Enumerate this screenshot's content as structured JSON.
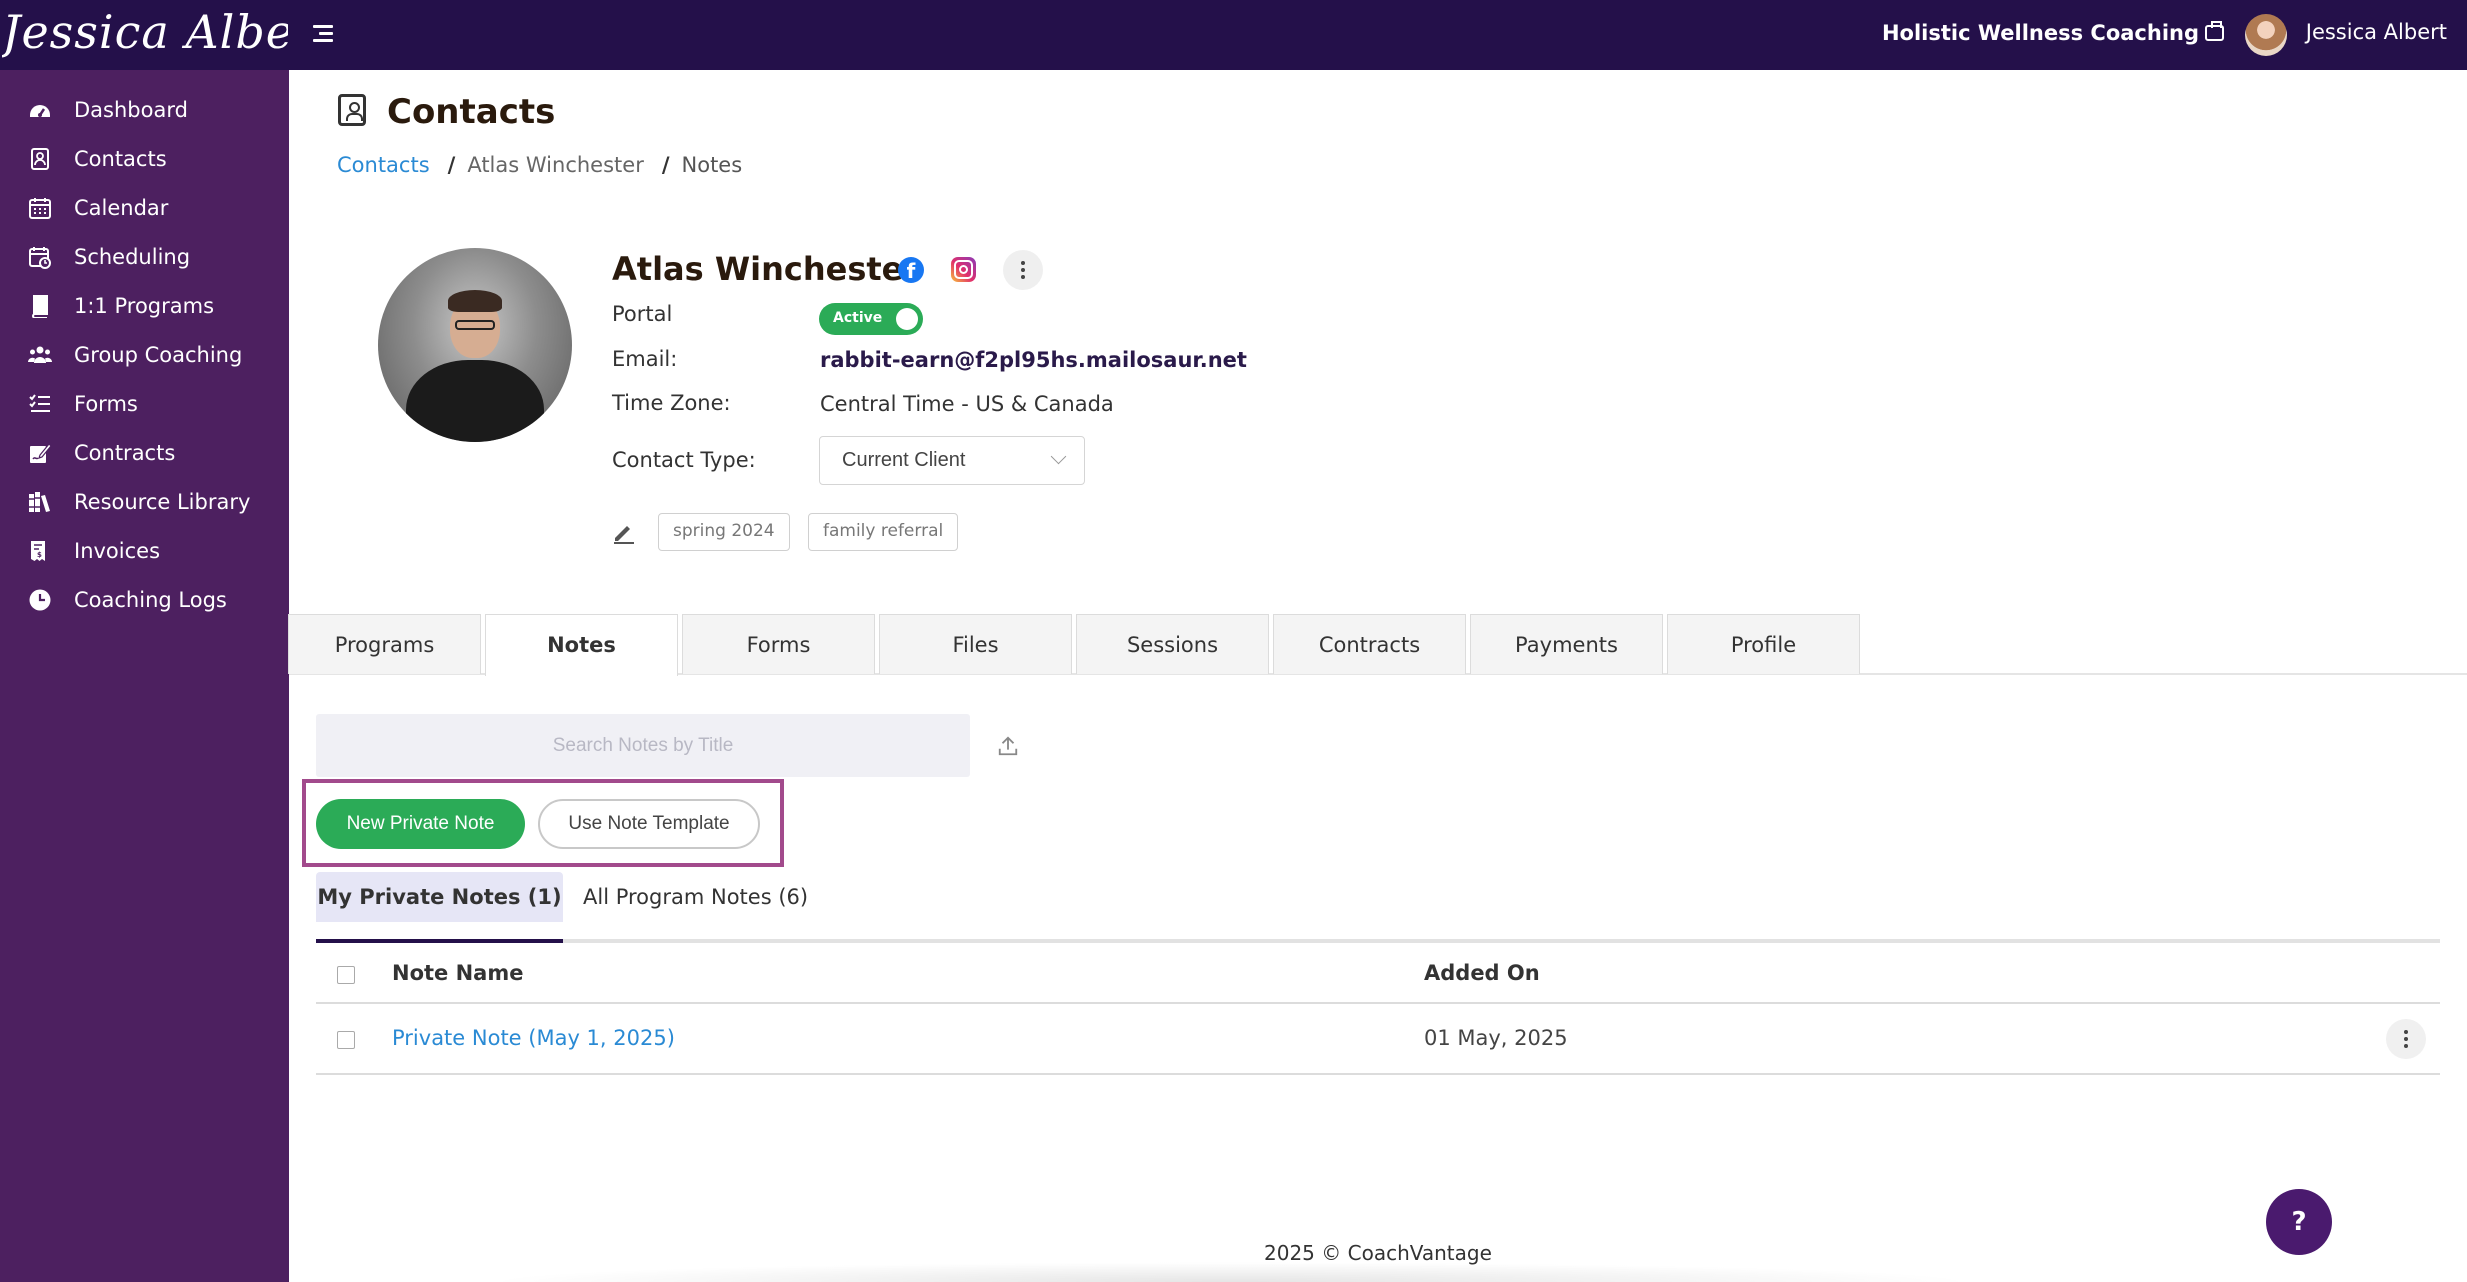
{
  "app": {
    "logo_text": "Jessica Albert",
    "business_name": "Holistic Wellness Coaching",
    "user_name": "Jessica Albert"
  },
  "sidebar": {
    "items": [
      {
        "label": "Dashboard",
        "icon": "dashboard-icon"
      },
      {
        "label": "Contacts",
        "icon": "contacts-icon"
      },
      {
        "label": "Calendar",
        "icon": "calendar-icon"
      },
      {
        "label": "Scheduling",
        "icon": "scheduling-icon"
      },
      {
        "label": "1:1 Programs",
        "icon": "book-icon"
      },
      {
        "label": "Group Coaching",
        "icon": "group-icon"
      },
      {
        "label": "Forms",
        "icon": "checklist-icon"
      },
      {
        "label": "Contracts",
        "icon": "signature-icon"
      },
      {
        "label": "Resource Library",
        "icon": "library-icon"
      },
      {
        "label": "Invoices",
        "icon": "invoice-icon"
      },
      {
        "label": "Coaching Logs",
        "icon": "clock-icon"
      }
    ]
  },
  "page": {
    "title": "Contacts",
    "breadcrumb": [
      "Contacts",
      "Atlas Winchester",
      "Notes"
    ],
    "breadcrumb_separator": "/"
  },
  "contact": {
    "name": "Atlas Winchester",
    "portal_label": "Portal",
    "portal_status": "Active",
    "email_label": "Email:",
    "email": "rabbit-earn@f2pl95hs.mailosaur.net",
    "timezone_label": "Time Zone:",
    "timezone": "Central Time - US & Canada",
    "contact_type_label": "Contact Type:",
    "contact_type": "Current Client",
    "tags": [
      "spring 2024",
      "family referral"
    ]
  },
  "tabs": [
    "Programs",
    "Notes",
    "Forms",
    "Files",
    "Sessions",
    "Contracts",
    "Payments",
    "Profile"
  ],
  "active_tab": "Notes",
  "notes": {
    "search_placeholder": "Search Notes by Title",
    "new_note_label": "New Private Note",
    "template_label": "Use Note Template",
    "subtabs": {
      "private": "My Private Notes (1)",
      "program": "All Program Notes (6)"
    },
    "columns": {
      "name": "Note Name",
      "added": "Added On"
    },
    "rows": [
      {
        "name": "Private Note (May 1, 2025)",
        "added": "01 May, 2025"
      }
    ]
  },
  "footer": {
    "text": "2025 © CoachVantage"
  },
  "help_label": "?",
  "colors": {
    "topbar": "#24104a",
    "sidebar": "#4d2060",
    "accent_green": "#2bab57",
    "link_blue": "#2a8ad4",
    "highlight": "#a24a8c"
  }
}
